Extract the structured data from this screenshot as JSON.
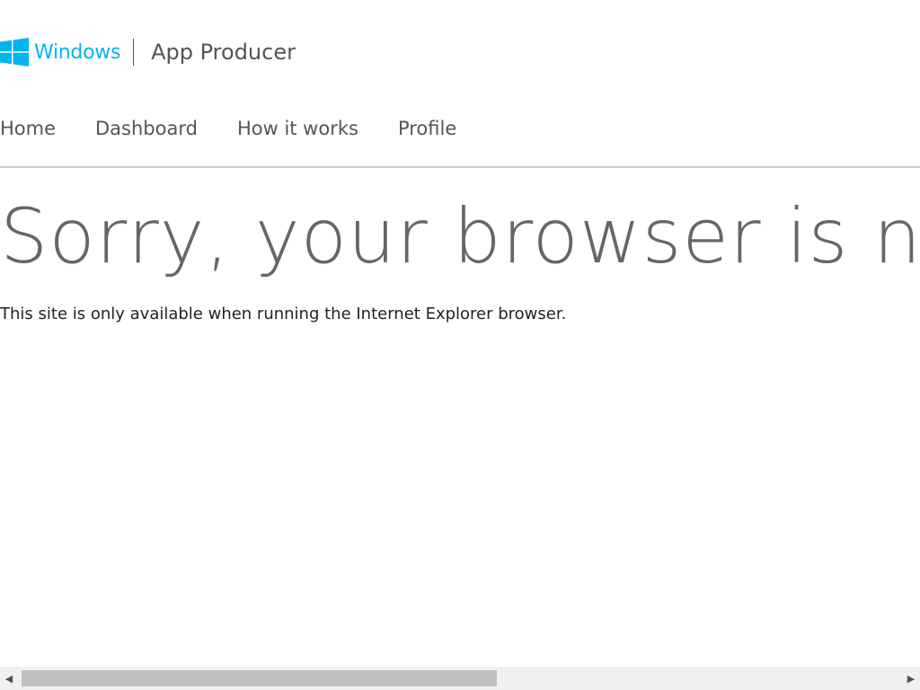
{
  "header": {
    "brand_text": "Windows",
    "brand_color": "#00b4f0",
    "logo_icon": "windows-logo-icon",
    "app_title": "App Producer"
  },
  "nav": {
    "items": [
      {
        "label": "Home"
      },
      {
        "label": "Dashboard"
      },
      {
        "label": "How it works"
      },
      {
        "label": "Profile"
      }
    ]
  },
  "main": {
    "headline": "Sorry, your browser is not supported",
    "message": "This site is only available when running the Internet Explorer browser."
  },
  "scrollbar": {
    "left_icon": "scroll-left-arrow-icon",
    "right_icon": "scroll-right-arrow-icon"
  }
}
